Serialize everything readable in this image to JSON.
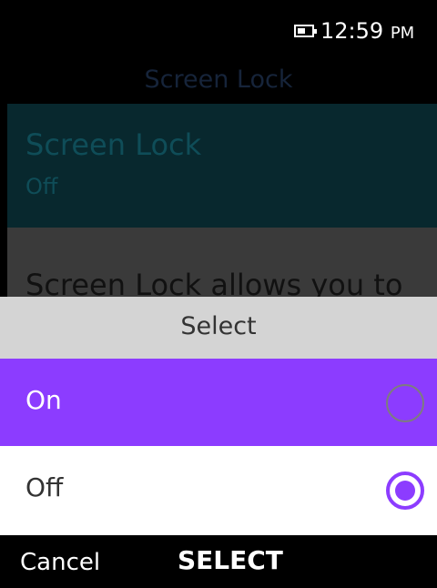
{
  "status_bar": {
    "battery_icon": "battery-icon",
    "time": "12:59",
    "ampm": "PM"
  },
  "background_screen": {
    "title": "Screen Lock",
    "setting": {
      "title": "Screen Lock",
      "value": "Off"
    },
    "description": "Screen Lock allows you to"
  },
  "dialog": {
    "title": "Select",
    "options": [
      {
        "label": "On",
        "selected": false,
        "focused": true
      },
      {
        "label": "Off",
        "selected": true,
        "focused": false
      }
    ]
  },
  "softkeys": {
    "left": "Cancel",
    "center": "SELECT",
    "right": ""
  },
  "colors": {
    "accent": "#8c3cff",
    "dialog_header": "#d4d4d4",
    "background": "#000000"
  }
}
